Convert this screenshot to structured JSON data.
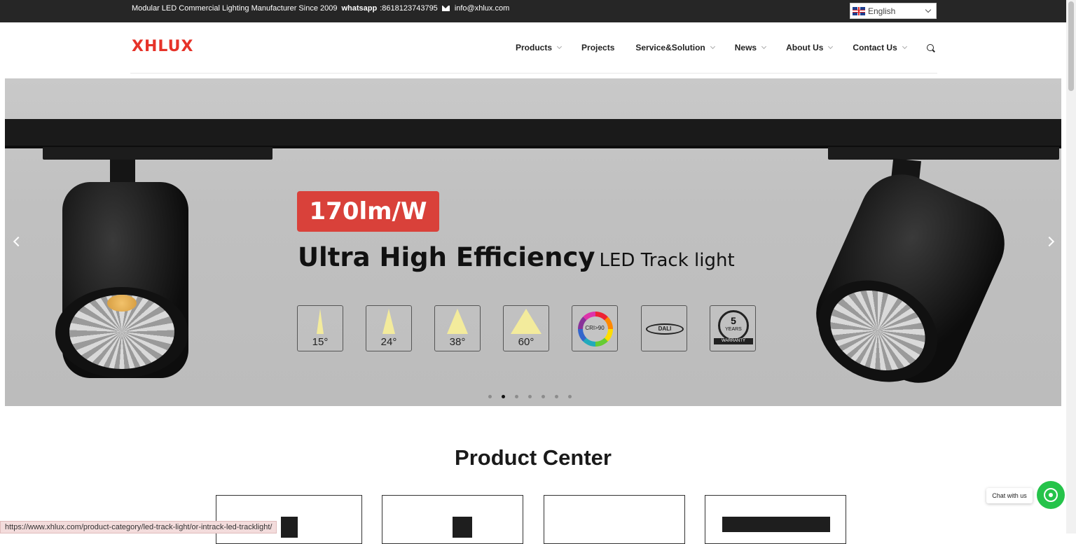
{
  "topbar": {
    "tagline": "Modular LED Commercial Lighting Manufacturer Since 2009",
    "whatsapp_label": "whatsapp",
    "whatsapp_number": ":8618123743795",
    "email": "info@xhlux.com",
    "language": "English"
  },
  "header": {
    "logo": "XHLUX",
    "nav": [
      {
        "label": "Products",
        "has_dropdown": true
      },
      {
        "label": "Projects",
        "has_dropdown": false
      },
      {
        "label": "Service&Solution",
        "has_dropdown": true
      },
      {
        "label": "News",
        "has_dropdown": true
      },
      {
        "label": "About Us",
        "has_dropdown": true
      },
      {
        "label": "Contact Us",
        "has_dropdown": true
      }
    ]
  },
  "hero": {
    "badge": "170lm/W",
    "headline": "Ultra High Efficiency",
    "subheadline": "LED Track light",
    "features": [
      "15°",
      "24°",
      "38°",
      "60°",
      "CRI>90",
      "DALI",
      "5 YEARS WARRANTY"
    ],
    "feature_parts": {
      "cri": "CRI>90",
      "dali": "DALI",
      "warranty_number": "5",
      "warranty_years": "YEARS",
      "warranty_ribbon": "WARRANTY"
    },
    "slide_count": 7,
    "active_slide": 2
  },
  "section": {
    "title": "Product Center"
  },
  "status_url": "https://www.xhlux.com/product-category/led-track-light/or-intrack-led-tracklight/",
  "chat": {
    "label": "Chat with us"
  },
  "colors": {
    "topbar_bg": "#262626",
    "brand_red": "#e63329",
    "badge_red": "#d9413a",
    "whatsapp_green": "#25c34a"
  }
}
